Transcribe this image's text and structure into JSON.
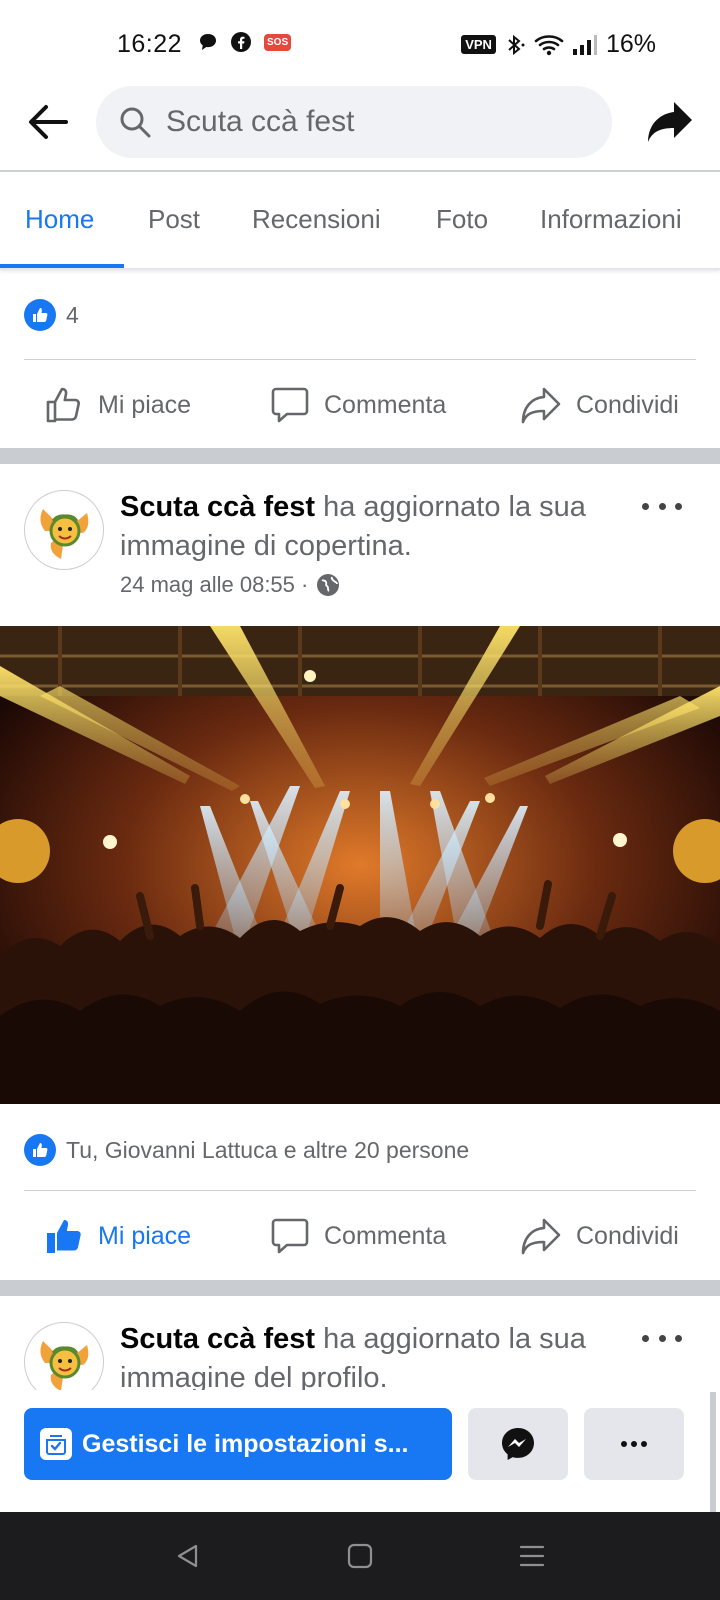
{
  "status_bar": {
    "time": "16:22",
    "sos": "SOS",
    "vpn": "VPN",
    "battery": "16%"
  },
  "search": {
    "placeholder": "Scuta ccà fest"
  },
  "tabs": [
    {
      "label": "Home"
    },
    {
      "label": "Post"
    },
    {
      "label": "Recensioni"
    },
    {
      "label": "Foto"
    },
    {
      "label": "Informazioni"
    }
  ],
  "post1": {
    "reaction_count": "4",
    "actions": {
      "like": "Mi piace",
      "comment": "Commenta",
      "share": "Condividi"
    }
  },
  "post2": {
    "author": "Scuta ccà fest",
    "action_text": " ha aggiornato la sua immagine di copertina.",
    "date": "24 mag alle 08:55 · ",
    "reactions": "Tu, Giovanni Lattuca e altre 20 persone",
    "actions": {
      "like": "Mi piace",
      "comment": "Commenta",
      "share": "Condividi"
    }
  },
  "post3": {
    "author": "Scuta ccà fest",
    "action_text": " ha aggiornato la sua immagine del profilo."
  },
  "bottom_bar": {
    "manage_label": "Gestisci le impostazioni s..."
  },
  "colors": {
    "accent": "#1877f2",
    "muted_text": "#65676b",
    "separator": "#c9ccd1"
  }
}
